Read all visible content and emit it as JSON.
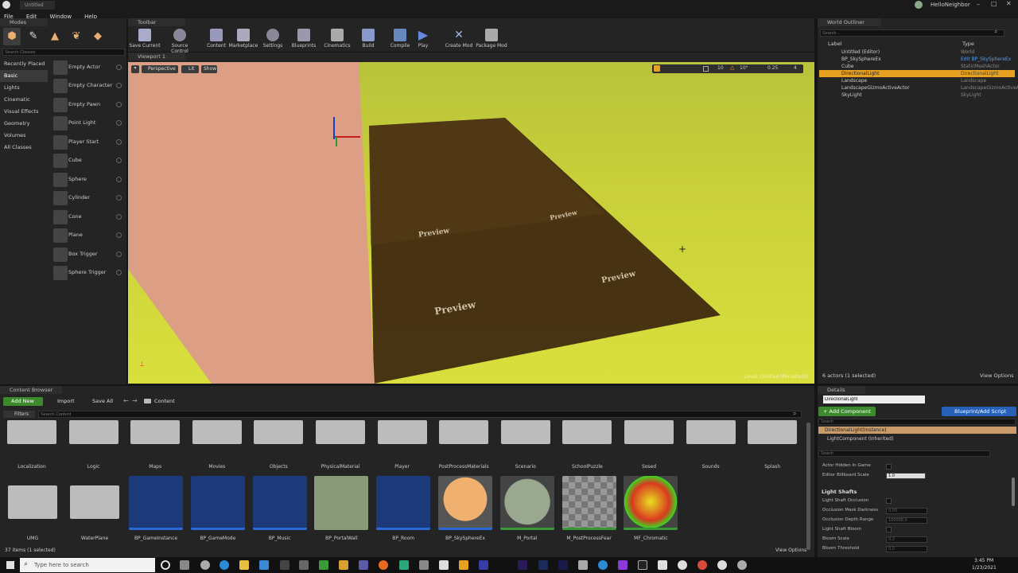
{
  "window": {
    "title": "Untitled",
    "user": "HelloNeighbor"
  },
  "menu": [
    "File",
    "Edit",
    "Window",
    "Help"
  ],
  "modes": {
    "tab": "Modes",
    "search_placeholder": "Search Classes",
    "categories": [
      "Recently Placed",
      "Basic",
      "Lights",
      "Cinematic",
      "Visual Effects",
      "Geometry",
      "Volumes",
      "All Classes"
    ],
    "items": [
      "Empty Actor",
      "Empty Character",
      "Empty Pawn",
      "Point Light",
      "Player Start",
      "Cube",
      "Sphere",
      "Cylinder",
      "Cone",
      "Plane",
      "Box Trigger",
      "Sphere Trigger"
    ]
  },
  "toolbar": {
    "tab": "Toolbar",
    "buttons": [
      "Save Current",
      "Source Control",
      "Content",
      "Marketplace",
      "Settings",
      "Blueprints",
      "Cinematics",
      "Build",
      "Compile",
      "Play",
      "Create Mod",
      "Package Mod"
    ]
  },
  "viewport": {
    "tab": "Viewport 1",
    "perspective": "Perspective",
    "lit": "Lit",
    "show": "Show",
    "snap_grid": "10",
    "snap_rot": "10°",
    "snap_scale": "0.25",
    "cam_speed": "4",
    "level": "Level:  Untitled (Persistent)",
    "preview_text": "Preview"
  },
  "outliner": {
    "tab": "World Outliner",
    "search_placeholder": "Search...",
    "col_label": "Label",
    "col_type": "Type",
    "rows": [
      {
        "label": "Untitled (Editor)",
        "type": "World"
      },
      {
        "label": "BP_SkySphereEx",
        "type": "Edit BP_SkySphereEx"
      },
      {
        "label": "Cube",
        "type": "StaticMeshActor"
      },
      {
        "label": "DirectionalLight",
        "type": "DirectionalLight"
      },
      {
        "label": "Landscape",
        "type": "Landscape"
      },
      {
        "label": "LandscapeGizmoActiveActor",
        "type": "LandscapeGizmoActiveActor"
      },
      {
        "label": "SkyLight",
        "type": "SkyLight"
      }
    ],
    "footer": "6 actors (1 selected)",
    "view_options": "View Options"
  },
  "details": {
    "tab": "Details",
    "name": "DirectionalLight",
    "add_component": "+ Add Component",
    "blueprint": "Blueprint/Add Script",
    "instance": "DirectionalLight(Instance)",
    "component": "LightComponent (Inherited)",
    "search_placeholder": "Search",
    "props": [
      {
        "label": "Actor Hidden In Game",
        "kind": "check"
      },
      {
        "label": "Editor Billboard Scale",
        "kind": "value",
        "value": "1.0"
      }
    ],
    "section": "Light Shafts",
    "shaft_props": [
      {
        "label": "Light Shaft Occlusion",
        "kind": "check"
      },
      {
        "label": "Occlusion Mask Darkness",
        "kind": "value",
        "value": "0.05"
      },
      {
        "label": "Occlusion Depth Range",
        "kind": "value",
        "value": "100000.0"
      },
      {
        "label": "Light Shaft Bloom",
        "kind": "check"
      },
      {
        "label": "Bloom Scale",
        "kind": "value",
        "value": "0.2"
      },
      {
        "label": "Bloom Threshold",
        "kind": "value",
        "value": "0.0"
      }
    ]
  },
  "content": {
    "tab": "Content Browser",
    "add_new": "Add New",
    "import": "Import",
    "save_all": "Save All",
    "path": "Content",
    "filters": "Filters",
    "search_placeholder": "Search Content",
    "folders_row1": [
      "Localization",
      "Logic",
      "Maps",
      "Movies",
      "Objects",
      "PhysicalMaterial",
      "Player",
      "PostProcessMaterials",
      "Scenario",
      "SchoolPuzzle",
      "Sosed",
      "Sounds",
      "Splash"
    ],
    "folders_row2": [
      "UMG",
      "WaterPlane"
    ],
    "assets": [
      "BP_GameInstance",
      "BP_GameMode",
      "BP_Music",
      "BP_PortalWall",
      "BP_Room",
      "BP_SkySphereEx",
      "M_Portal",
      "M_PostProcessFear",
      "MF_Chromatic"
    ],
    "status": "37 items (1 selected)",
    "view_options": "View Options"
  },
  "taskbar": {
    "search_placeholder": "Type here to search",
    "time": "3:45 PM",
    "date": "1/23/2021"
  }
}
